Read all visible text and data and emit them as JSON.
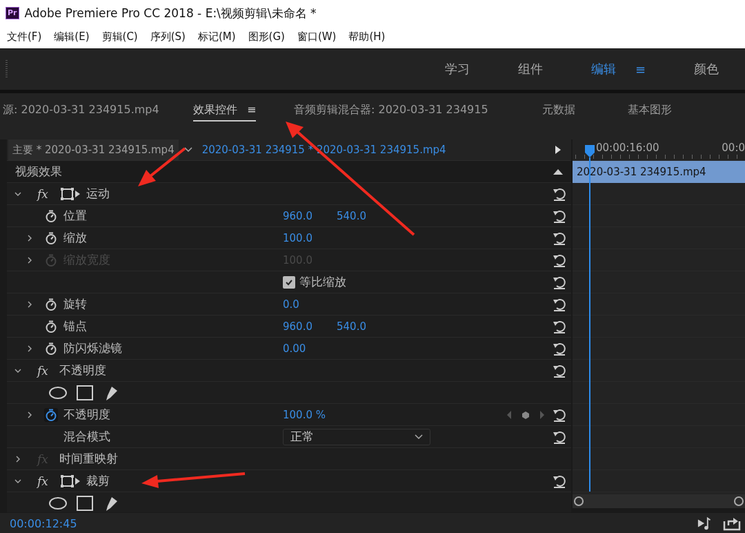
{
  "window": {
    "app_icon": "Pr",
    "title": "Adobe Premiere Pro CC 2018 - E:\\视频剪辑\\未命名 *"
  },
  "menu": [
    "文件(F)",
    "编辑(E)",
    "剪辑(C)",
    "序列(S)",
    "标记(M)",
    "图形(G)",
    "窗口(W)",
    "帮助(H)"
  ],
  "workspaces": [
    {
      "label": "学习",
      "selected": false
    },
    {
      "label": "组件",
      "selected": false
    },
    {
      "label": "编辑",
      "selected": true,
      "menu_glyph": "≡"
    },
    {
      "label": "颜色",
      "selected": false
    }
  ],
  "panel_tabs": [
    {
      "label": "源: 2020-03-31 234915.mp4",
      "selected": false
    },
    {
      "label": "效果控件",
      "selected": true,
      "menu_glyph": "≡"
    },
    {
      "label": "音频剪辑混合器: 2020-03-31 234915",
      "selected": false
    },
    {
      "label": "元数据",
      "selected": false
    },
    {
      "label": "基本图形",
      "selected": false
    }
  ],
  "effect_controls": {
    "master_clip": "主要 * 2020-03-31 234915.mp4",
    "sequence_clip": "2020-03-31 234915 * 2020-03-31 234915.mp4",
    "section_title": "视频效果",
    "rows": [
      {
        "kind": "section",
        "label": "运动",
        "badge": "fx",
        "expanded": true,
        "fx_enabled": true,
        "transform_icon": true,
        "reset": true
      },
      {
        "kind": "param",
        "label": "位置",
        "values": [
          "960.0",
          "540.0"
        ],
        "disabled": false,
        "animating": false,
        "keyframe_nav": false,
        "reset": true
      },
      {
        "kind": "param",
        "label": "缩放",
        "expanded": false,
        "values": [
          "100.0"
        ],
        "disabled": false,
        "animating": false,
        "keyframe_nav": false,
        "reset": true
      },
      {
        "kind": "param",
        "label": "缩放宽度",
        "expanded": false,
        "values": [
          "100.0"
        ],
        "disabled": true,
        "animating": false,
        "keyframe_nav": false,
        "reset": true
      },
      {
        "kind": "checkbox",
        "label": "等比缩放",
        "checked": true,
        "reset": true
      },
      {
        "kind": "param",
        "label": "旋转",
        "expanded": false,
        "values": [
          "0.0"
        ],
        "disabled": false,
        "animating": false,
        "keyframe_nav": false,
        "reset": true
      },
      {
        "kind": "param",
        "label": "锚点",
        "values": [
          "960.0",
          "540.0"
        ],
        "disabled": false,
        "animating": false,
        "keyframe_nav": false,
        "reset": true
      },
      {
        "kind": "param",
        "label": "防闪烁滤镜",
        "expanded": false,
        "values": [
          "0.00"
        ],
        "disabled": false,
        "animating": false,
        "keyframe_nav": false,
        "reset": true
      },
      {
        "kind": "section",
        "label": "不透明度",
        "badge": "fx",
        "expanded": true,
        "fx_enabled": true,
        "transform_icon": false,
        "reset": true
      },
      {
        "kind": "masks"
      },
      {
        "kind": "param",
        "label": "不透明度",
        "expanded": false,
        "values": [
          "100.0 %"
        ],
        "disabled": false,
        "animating": true,
        "keyframe_nav": true,
        "reset": true
      },
      {
        "kind": "dropdown",
        "label": "混合模式",
        "value": "正常",
        "reset": true
      },
      {
        "kind": "section",
        "label": "时间重映射",
        "badge": "fx",
        "expanded": false,
        "fx_enabled": false,
        "transform_icon": false,
        "reset": false
      },
      {
        "kind": "section",
        "label": "裁剪",
        "badge": "fx",
        "expanded": true,
        "fx_enabled": true,
        "transform_icon": true,
        "reset": true
      },
      {
        "kind": "masks"
      }
    ],
    "timecode": "00:00:12:45"
  },
  "timeline": {
    "ruler_labels": [
      "00:00:16:00",
      "00:0"
    ],
    "clip": "2020-03-31 234915.mp4"
  }
}
